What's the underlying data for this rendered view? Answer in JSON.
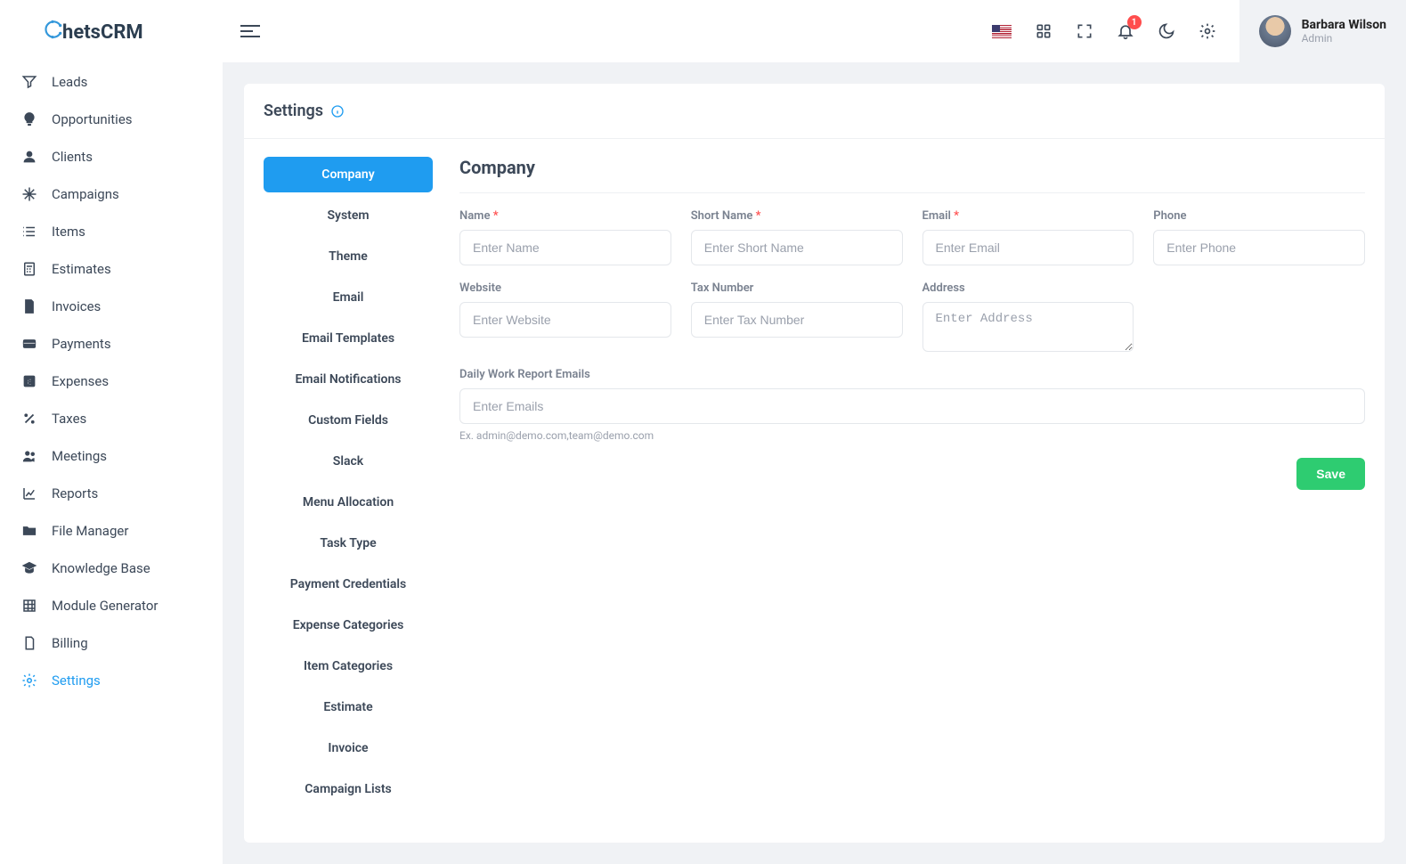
{
  "brand": {
    "name": "hetsCRM"
  },
  "sidebar": {
    "items": [
      {
        "label": "Leads"
      },
      {
        "label": "Opportunities"
      },
      {
        "label": "Clients"
      },
      {
        "label": "Campaigns"
      },
      {
        "label": "Items"
      },
      {
        "label": "Estimates"
      },
      {
        "label": "Invoices"
      },
      {
        "label": "Payments"
      },
      {
        "label": "Expenses"
      },
      {
        "label": "Taxes"
      },
      {
        "label": "Meetings"
      },
      {
        "label": "Reports"
      },
      {
        "label": "File Manager"
      },
      {
        "label": "Knowledge Base"
      },
      {
        "label": "Module Generator"
      },
      {
        "label": "Billing"
      },
      {
        "label": "Settings"
      }
    ]
  },
  "topbar": {
    "notification_count": "1",
    "user_name": "Barbara Wilson",
    "user_role": "Admin"
  },
  "page": {
    "title": "Settings"
  },
  "settings_tabs": [
    {
      "label": "Company"
    },
    {
      "label": "System"
    },
    {
      "label": "Theme"
    },
    {
      "label": "Email"
    },
    {
      "label": "Email Templates"
    },
    {
      "label": "Email Notifications"
    },
    {
      "label": "Custom Fields"
    },
    {
      "label": "Slack"
    },
    {
      "label": "Menu Allocation"
    },
    {
      "label": "Task Type"
    },
    {
      "label": "Payment Credentials"
    },
    {
      "label": "Expense Categories"
    },
    {
      "label": "Item Categories"
    },
    {
      "label": "Estimate"
    },
    {
      "label": "Invoice"
    },
    {
      "label": "Campaign Lists"
    }
  ],
  "form": {
    "title": "Company",
    "name": {
      "label": "Name",
      "placeholder": "Enter Name"
    },
    "short_name": {
      "label": "Short Name",
      "placeholder": "Enter Short Name"
    },
    "email": {
      "label": "Email",
      "placeholder": "Enter Email"
    },
    "phone": {
      "label": "Phone",
      "placeholder": "Enter Phone"
    },
    "website": {
      "label": "Website",
      "placeholder": "Enter Website"
    },
    "tax_number": {
      "label": "Tax Number",
      "placeholder": "Enter Tax Number"
    },
    "address": {
      "label": "Address",
      "placeholder": "Enter Address"
    },
    "daily_emails": {
      "label": "Daily Work Report Emails",
      "placeholder": "Enter Emails"
    },
    "daily_emails_help": "Ex. admin@demo.com,team@demo.com",
    "save_label": "Save"
  }
}
